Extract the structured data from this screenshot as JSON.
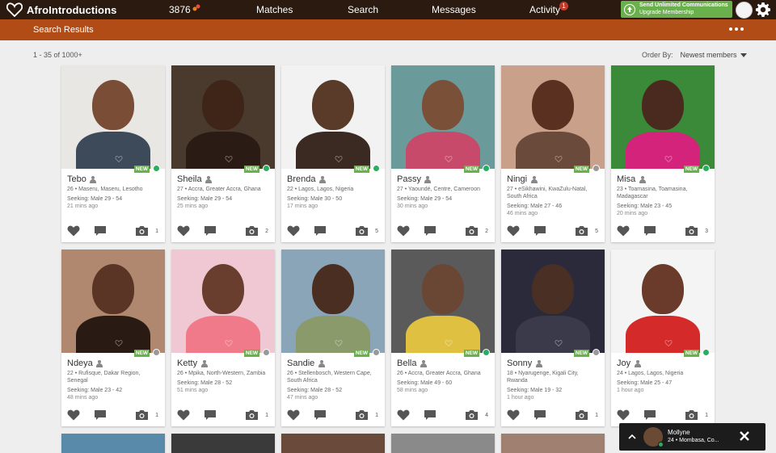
{
  "brand": {
    "name": "AfroIntroductions",
    "accent": "#b24c17",
    "nav_bg": "#2b1a10",
    "online": "#27ae60",
    "new_badge": "#6ab04c"
  },
  "nav": {
    "count": "3876",
    "matches": "Matches",
    "search": "Search",
    "messages": "Messages",
    "activity": "Activity",
    "activity_badge": "1",
    "upgrade_line1": "Send Unlimited Communications",
    "upgrade_line2": "Upgrade Membership"
  },
  "subheader": {
    "title": "Search Results"
  },
  "results": {
    "count": "1 - 35 of 1000+",
    "order_by_label": "Order By:",
    "order_by_value": "Newest members"
  },
  "profiles": [
    {
      "name": "Tebo",
      "loc": "26 • Maseru, Maseru, Lesotho",
      "seeking": "Seeking: Male 29 - 54",
      "ago": "21 mins ago",
      "photos": "1",
      "new": "NEW",
      "online": true,
      "skin": "#7a4e36",
      "bg": "#e9e7e4",
      "top": "#3d4a5a"
    },
    {
      "name": "Sheila",
      "loc": "27 • Accra, Greater Accra, Ghana",
      "seeking": "Seeking: Male 29 - 54",
      "ago": "25 mins ago",
      "photos": "2",
      "new": "NEW",
      "online": true,
      "skin": "#3e2518",
      "bg": "#4a3a2e",
      "top": "#2a1c14"
    },
    {
      "name": "Brenda",
      "loc": "22 • Lagos, Lagos, Nigeria",
      "seeking": "Seeking: Male 30 - 50",
      "ago": "17 mins ago",
      "photos": "5",
      "new": "NEW",
      "online": true,
      "skin": "#5a3a28",
      "bg": "#f2f2f2",
      "top": "#3a2a22"
    },
    {
      "name": "Passy",
      "loc": "27 • Yaoundé, Centre, Cameroon",
      "seeking": "Seeking: Male 29 - 54",
      "ago": "30 mins ago",
      "photos": "2",
      "new": "NEW",
      "online": true,
      "skin": "#7b5038",
      "bg": "#6a9a9a",
      "top": "#c84a6a"
    },
    {
      "name": "Ningi",
      "loc": "27 • eSikhawini, KwaZulu-Natal, South Africa",
      "seeking": "Seeking: Male 27 - 46",
      "ago": "46 mins ago",
      "photos": "5",
      "new": "NEW",
      "online": false,
      "skin": "#5a3020",
      "bg": "#c9a08a",
      "top": "#6a4a3a"
    },
    {
      "name": "Misa",
      "loc": "23 • Toamasina, Toamasina, Madagascar",
      "seeking": "Seeking: Male 23 - 45",
      "ago": "20 mins ago",
      "photos": "3",
      "new": "NEW",
      "online": true,
      "skin": "#4a2a1e",
      "bg": "#3a8a3a",
      "top": "#d4237a"
    },
    {
      "name": "Ndeya",
      "loc": "22 • Rufisque, Dakar Region, Senegal",
      "seeking": "Seeking: Male 23 - 42",
      "ago": "48 mins ago",
      "photos": "1",
      "new": "NEW",
      "online": false,
      "skin": "#5a3424",
      "bg": "#b08870",
      "top": "#2a1a14"
    },
    {
      "name": "Ketty",
      "loc": "26 • Mpika, North-Western, Zambia",
      "seeking": "Seeking: Male 28 - 52",
      "ago": "51 mins ago",
      "photos": "1",
      "new": "NEW",
      "online": false,
      "skin": "#6a3e2e",
      "bg": "#f0c8d4",
      "top": "#f07a8a"
    },
    {
      "name": "Sandie",
      "loc": "26 • Stellenbosch, Western Cape, South Africa",
      "seeking": "Seeking: Male 28 - 52",
      "ago": "47 mins ago",
      "photos": "1",
      "new": "NEW",
      "online": false,
      "skin": "#4a2e22",
      "bg": "#8aa4b8",
      "top": "#8a9a6a"
    },
    {
      "name": "Bella",
      "loc": "26 • Accra, Greater Accra, Ghana",
      "seeking": "Seeking: Male 49 - 60",
      "ago": "58 mins ago",
      "photos": "4",
      "new": "NEW",
      "online": true,
      "skin": "#6a4634",
      "bg": "#5a5a5a",
      "top": "#e0c040"
    },
    {
      "name": "Sonny",
      "loc": "18 • Nyarugenge, Kigali City, Rwanda",
      "seeking": "Seeking: Male 19 - 32",
      "ago": "1 hour ago",
      "photos": "1",
      "new": "NEW",
      "online": false,
      "skin": "#4a3024",
      "bg": "#2a2a3a",
      "top": "#3a3a4a"
    },
    {
      "name": "Joy",
      "loc": "24 • Lagos, Lagos, Nigeria",
      "seeking": "Seeking: Male 25 - 47",
      "ago": "1 hour ago",
      "photos": "1",
      "new": "NEW",
      "online": true,
      "skin": "#6a3a2a",
      "bg": "#f4f4f4",
      "top": "#d42a2a"
    }
  ],
  "partial_row": [
    {
      "bg": "#5a8aaa"
    },
    {
      "bg": "#3a3a3a"
    },
    {
      "bg": "#6a4a3a"
    },
    {
      "bg": "#8a8a8a"
    },
    {
      "bg": "#a08070"
    }
  ],
  "chat": {
    "name": "Mollyne",
    "sub": "24 • Mombasa, Co..."
  }
}
